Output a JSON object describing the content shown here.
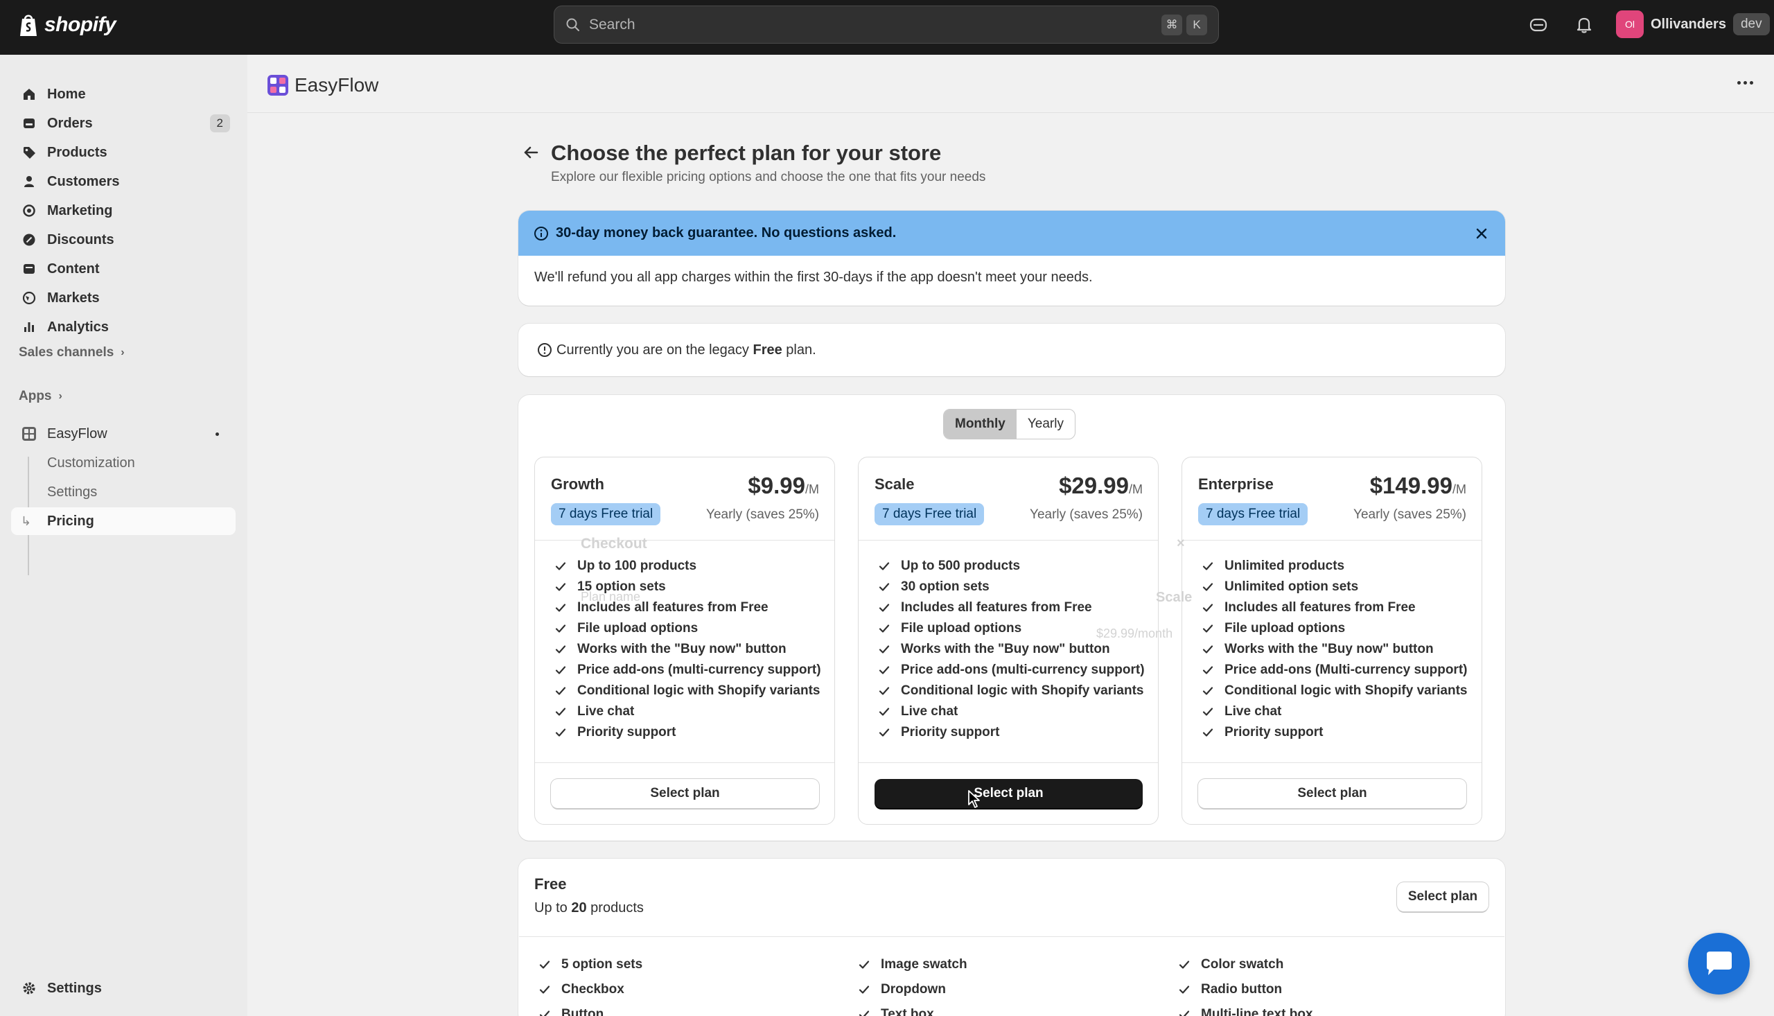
{
  "topbar": {
    "logo_text": "shopify",
    "search_placeholder": "Search",
    "shortcut_keys": [
      "⌘",
      "K"
    ],
    "store_initials": "Ol",
    "store_name": "Ollivanders",
    "store_badge": "dev"
  },
  "sidebar": {
    "items": [
      {
        "label": "Home",
        "icon": "home-icon"
      },
      {
        "label": "Orders",
        "icon": "orders-icon",
        "count": "2"
      },
      {
        "label": "Products",
        "icon": "tag-icon"
      },
      {
        "label": "Customers",
        "icon": "person-icon"
      },
      {
        "label": "Marketing",
        "icon": "target-icon"
      },
      {
        "label": "Discounts",
        "icon": "discount-icon"
      },
      {
        "label": "Content",
        "icon": "content-icon"
      },
      {
        "label": "Markets",
        "icon": "globe-icon"
      },
      {
        "label": "Analytics",
        "icon": "bar-chart-icon"
      }
    ],
    "sales_channels": "Sales channels",
    "apps": "Apps",
    "app_name": "EasyFlow",
    "app_subitems": [
      "Customization",
      "Settings",
      "Pricing"
    ],
    "settings": "Settings"
  },
  "app": {
    "title": "EasyFlow"
  },
  "page": {
    "title": "Choose the perfect plan for your store",
    "subtitle": "Explore our flexible pricing options and choose the one that fits your needs"
  },
  "banner": {
    "title": "30-day money back guarantee. No questions asked.",
    "body": "We'll refund you all app charges within the first 30-days if the app doesn't meet your needs."
  },
  "legacy": {
    "prefix": "Currently you are on the legacy ",
    "plan": "Free",
    "suffix": " plan."
  },
  "billing_toggle": {
    "options": [
      "Monthly",
      "Yearly"
    ],
    "selected": "Monthly"
  },
  "plans": [
    {
      "name": "Growth",
      "price": "$9.99",
      "unit": "/M",
      "trial": "7 days Free trial",
      "yearly": "Yearly (saves 25%)",
      "features": [
        "Up to 100 products",
        "15 option sets",
        "Includes all features from Free",
        "File upload options",
        "Works with the \"Buy now\" button",
        "Price add-ons (multi-currency support)",
        "Conditional logic with Shopify variants",
        "Live chat",
        "Priority support"
      ],
      "button": "Select plan"
    },
    {
      "name": "Scale",
      "price": "$29.99",
      "unit": "/M",
      "trial": "7 days Free trial",
      "yearly": "Yearly (saves 25%)",
      "features": [
        "Up to 500 products",
        "30 option sets",
        "Includes all features from Free",
        "File upload options",
        "Works with the \"Buy now\" button",
        "Price add-ons (multi-currency support)",
        "Conditional logic with Shopify variants",
        "Live chat",
        "Priority support"
      ],
      "button": "Select plan"
    },
    {
      "name": "Enterprise",
      "price": "$149.99",
      "unit": "/M",
      "trial": "7 days Free trial",
      "yearly": "Yearly (saves 25%)",
      "features": [
        "Unlimited products",
        "Unlimited option sets",
        "Includes all features from Free",
        "File upload options",
        "Works with the \"Buy now\" button",
        "Price add-ons (Multi-currency support)",
        "Conditional logic with Shopify variants",
        "Live chat",
        "Priority support"
      ],
      "button": "Select plan"
    }
  ],
  "checkout_ghost": {
    "title": "Checkout",
    "plan_name_label": "Plan name",
    "plan_value": "Scale",
    "price": "$29.99/month"
  },
  "free_plan": {
    "name": "Free",
    "sub_prefix": "Up to ",
    "sub_count": "20",
    "sub_suffix": " products",
    "button": "Select plan",
    "features_col1": [
      "5 option sets",
      "Checkbox",
      "Button"
    ],
    "features_col2": [
      "Image swatch",
      "Dropdown",
      "Text box"
    ],
    "features_col3": [
      "Color swatch",
      "Radio button",
      "Multi-line text box"
    ]
  },
  "colors": {
    "topbar": "#1a1a1a",
    "banner": "#7ab8f0",
    "trial_badge": "#a4cdf5",
    "chat": "#1a6fd6",
    "avatar": "#e0457b"
  }
}
